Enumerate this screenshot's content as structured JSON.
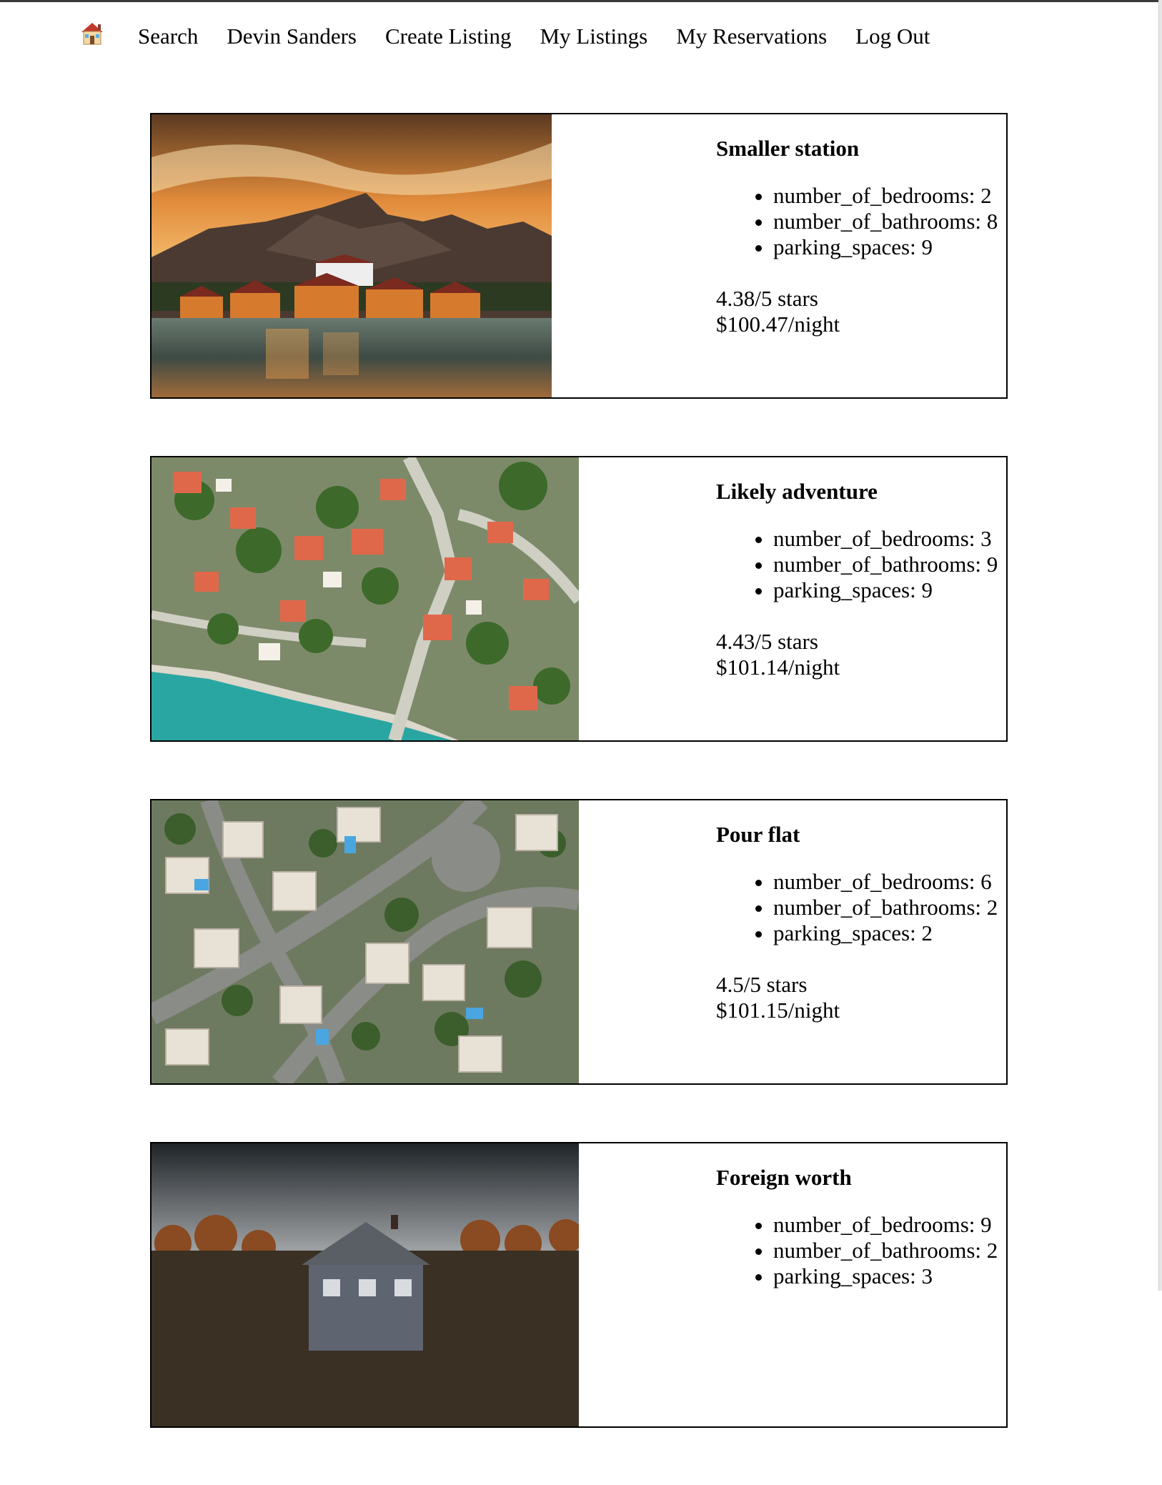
{
  "nav": {
    "home_icon": "house-emoji-icon",
    "items": [
      {
        "label": "Search"
      },
      {
        "label": "Devin Sanders"
      },
      {
        "label": "Create Listing"
      },
      {
        "label": "My Listings"
      },
      {
        "label": "My Reservations"
      },
      {
        "label": "Log Out"
      }
    ]
  },
  "listings": [
    {
      "title": "Smaller station",
      "photo": "photo-lakeside-mountain-village-sunset",
      "attributes": [
        "number_of_bedrooms: 2",
        "number_of_bathrooms: 8",
        "parking_spaces: 9"
      ],
      "rating": "4.38/5 stars",
      "price": "$100.47/night"
    },
    {
      "title": "Likely adventure",
      "photo": "photo-aerial-coastal-town",
      "attributes": [
        "number_of_bedrooms: 3",
        "number_of_bathrooms: 9",
        "parking_spaces: 9"
      ],
      "rating": "4.43/5 stars",
      "price": "$101.14/night"
    },
    {
      "title": "Pour flat",
      "photo": "photo-aerial-suburb-villas",
      "attributes": [
        "number_of_bedrooms: 6",
        "number_of_bathrooms: 2",
        "parking_spaces: 2"
      ],
      "rating": "4.5/5 stars",
      "price": "$101.15/night"
    },
    {
      "title": "Foreign worth",
      "photo": "photo-house-in-autumn-forest",
      "attributes": [
        "number_of_bedrooms: 9",
        "number_of_bathrooms: 2",
        "parking_spaces: 3"
      ],
      "rating": "",
      "price": ""
    }
  ]
}
